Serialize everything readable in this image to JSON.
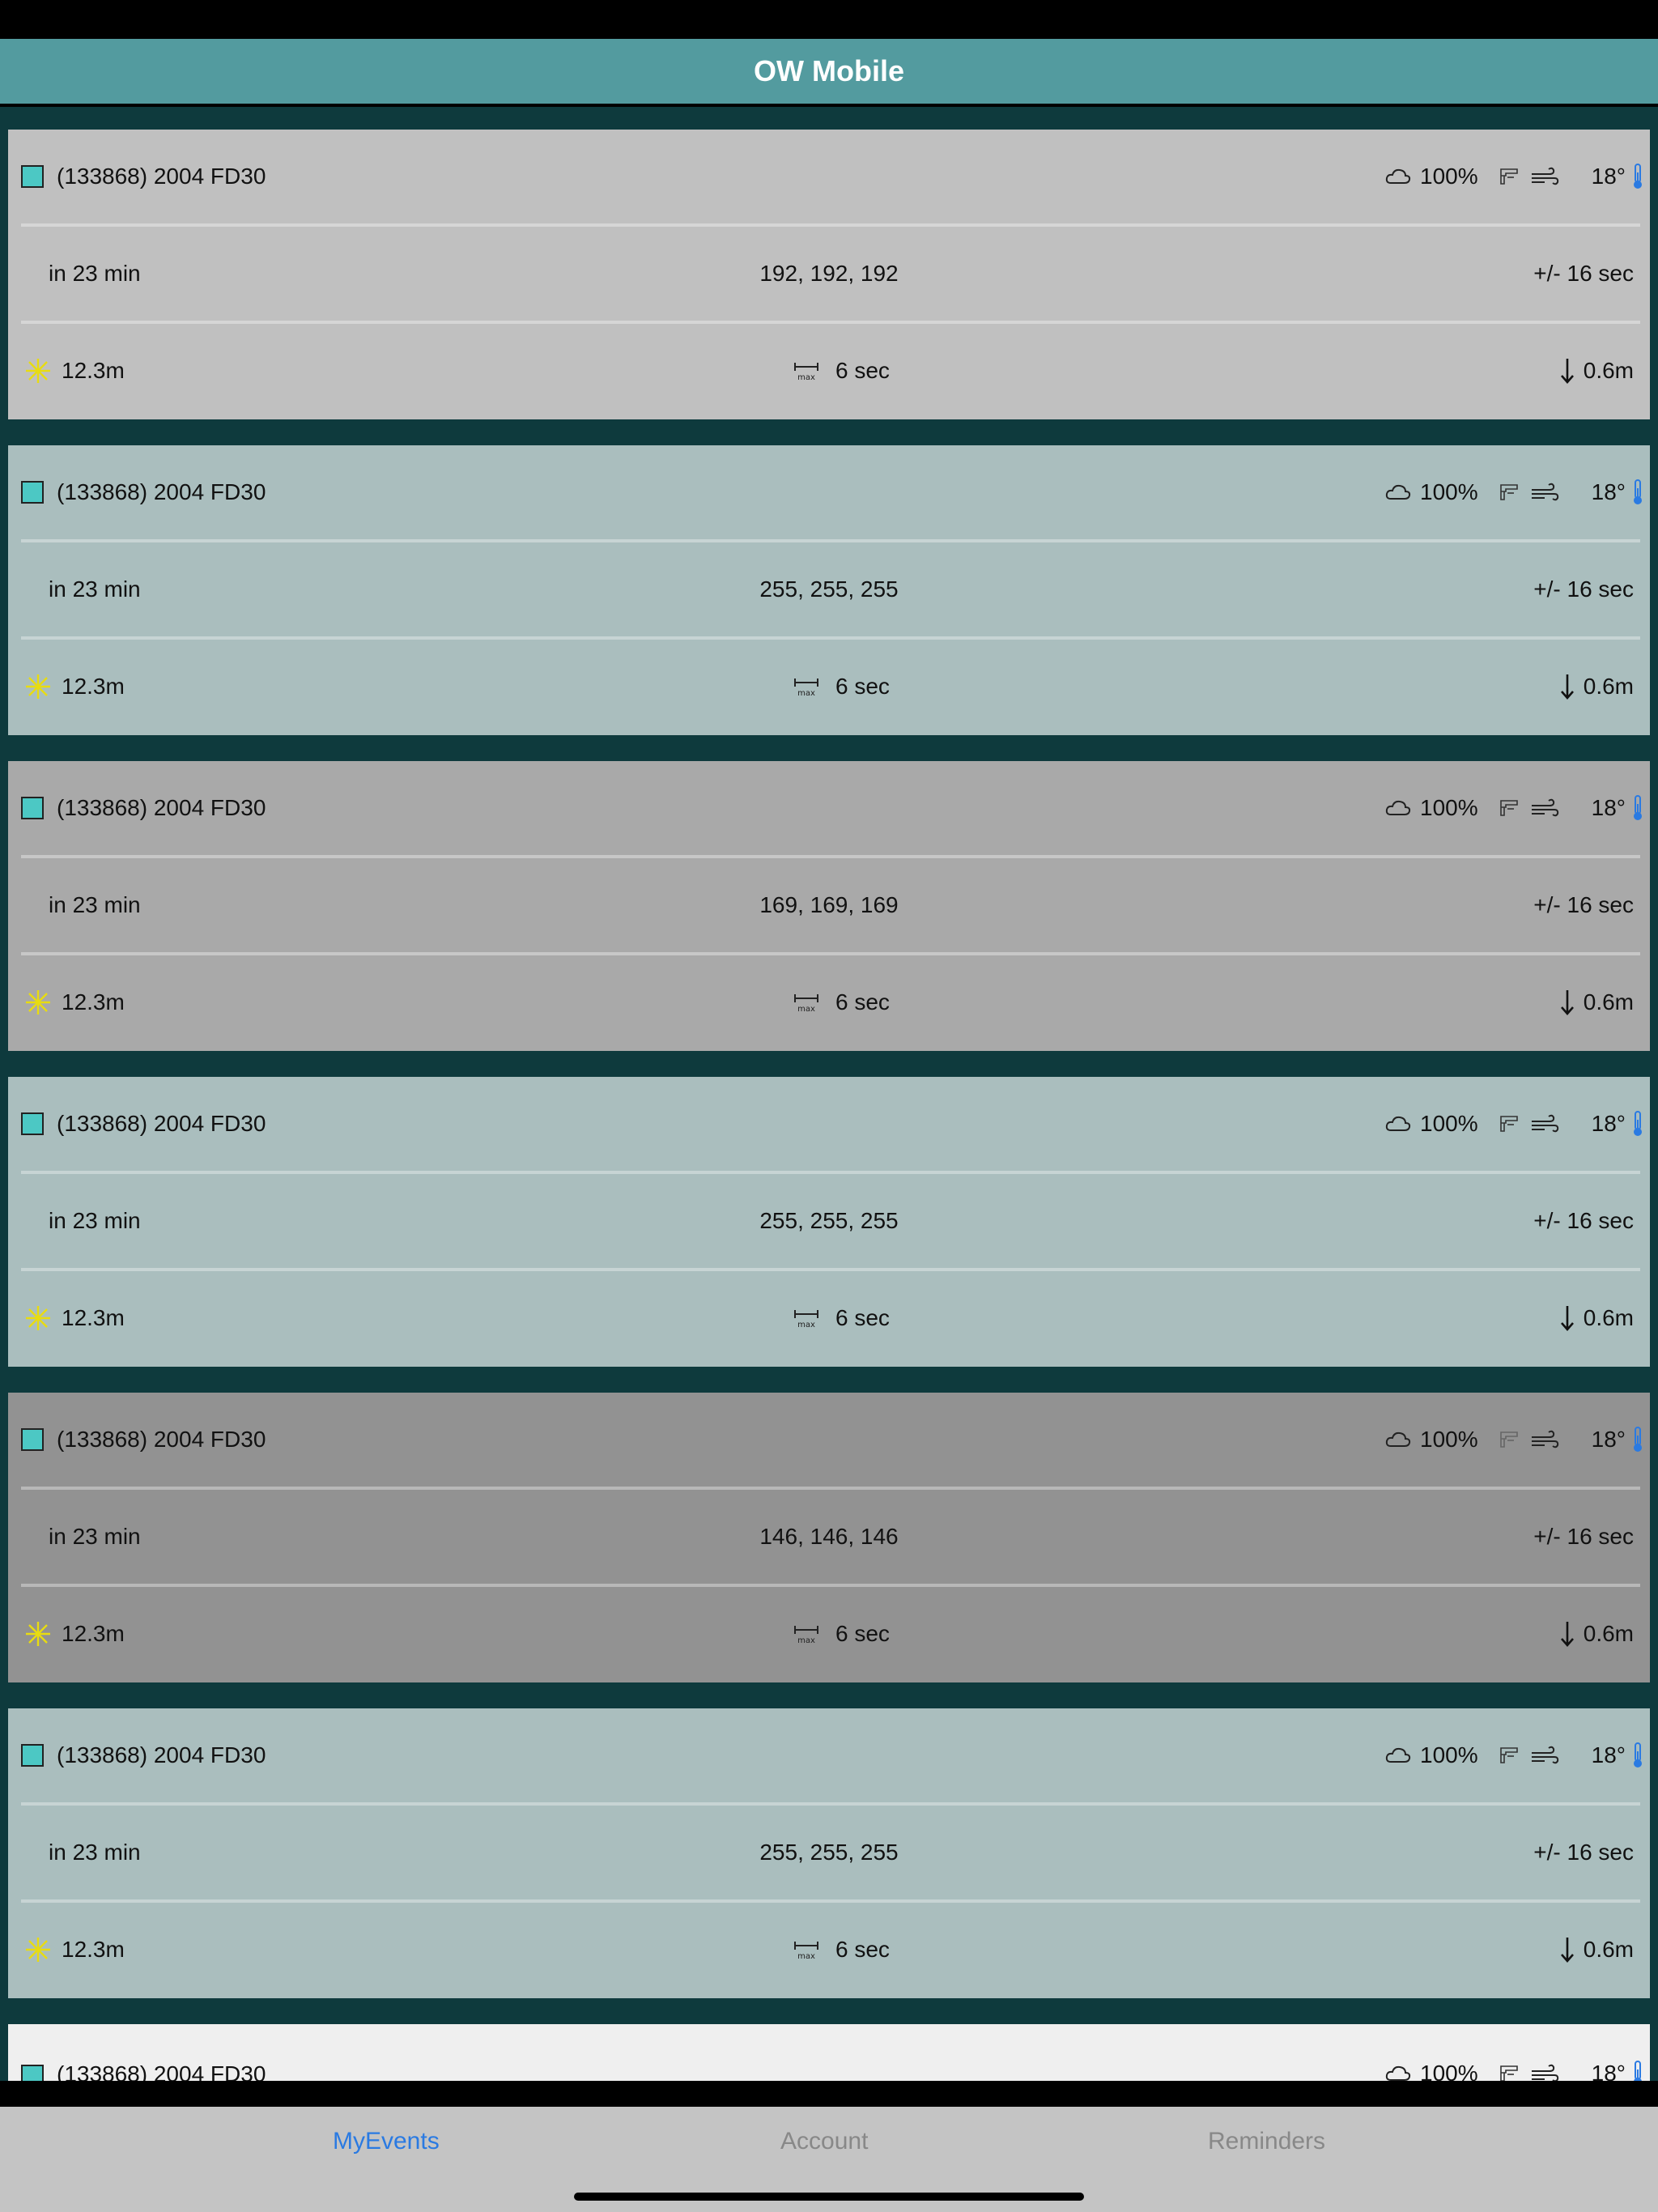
{
  "app": {
    "title": "OW Mobile"
  },
  "events": [
    {
      "name": "(133868) 2004 FD30",
      "cloud": "100%",
      "temp": "18°",
      "time_left": "in 23 min",
      "color_text": "192, 192, 192",
      "tolerance": "+/- 16 sec",
      "sun_alt": "12.3m",
      "duration": "6 sec",
      "depth": "0.6m",
      "bg": "#c0c0c0"
    },
    {
      "name": "(133868) 2004 FD30",
      "cloud": "100%",
      "temp": "18°",
      "time_left": "in 23 min",
      "color_text": "255, 255, 255",
      "tolerance": "+/- 16 sec",
      "sun_alt": "12.3m",
      "duration": "6 sec",
      "depth": "0.6m",
      "bg": "#aabebe"
    },
    {
      "name": "(133868) 2004 FD30",
      "cloud": "100%",
      "temp": "18°",
      "time_left": "in 23 min",
      "color_text": "169, 169, 169",
      "tolerance": "+/- 16 sec",
      "sun_alt": "12.3m",
      "duration": "6 sec",
      "depth": "0.6m",
      "bg": "#a9a9a9"
    },
    {
      "name": "(133868) 2004 FD30",
      "cloud": "100%",
      "temp": "18°",
      "time_left": "in 23 min",
      "color_text": "255, 255, 255",
      "tolerance": "+/- 16 sec",
      "sun_alt": "12.3m",
      "duration": "6 sec",
      "depth": "0.6m",
      "bg": "#aabebe"
    },
    {
      "name": "(133868) 2004 FD30",
      "cloud": "100%",
      "temp": "18°",
      "time_left": "in 23 min",
      "color_text": "146, 146, 146",
      "tolerance": "+/- 16 sec",
      "sun_alt": "12.3m",
      "duration": "6 sec",
      "depth": "0.6m",
      "bg": "#929292"
    },
    {
      "name": "(133868) 2004 FD30",
      "cloud": "100%",
      "temp": "18°",
      "time_left": "in 23 min",
      "color_text": "255, 255, 255",
      "tolerance": "+/- 16 sec",
      "sun_alt": "12.3m",
      "duration": "6 sec",
      "depth": "0.6m",
      "bg": "#aabebe"
    },
    {
      "name": "(133868) 2004 FD30",
      "cloud": "100%",
      "temp": "18°",
      "bg": "#efefef"
    }
  ],
  "tabs": [
    {
      "label": "MyEvents",
      "active": true
    },
    {
      "label": "Account",
      "active": false
    },
    {
      "label": "Reminders",
      "active": false
    }
  ],
  "colors": {
    "nav": "#539b9f",
    "list_bg": "#0e3a3d",
    "marker": "#4cc8c4",
    "tab_active": "#2a7ae2",
    "thermo": "#2a7ae2",
    "sun": "#f0e020"
  },
  "icons": {
    "cloud": "cloud-icon",
    "rain": "rain-gauge-icon",
    "wind": "wind-icon",
    "thermometer": "thermometer-icon",
    "sun": "sun-icon",
    "duration": "max-duration-icon",
    "depth": "down-arrow-icon"
  }
}
